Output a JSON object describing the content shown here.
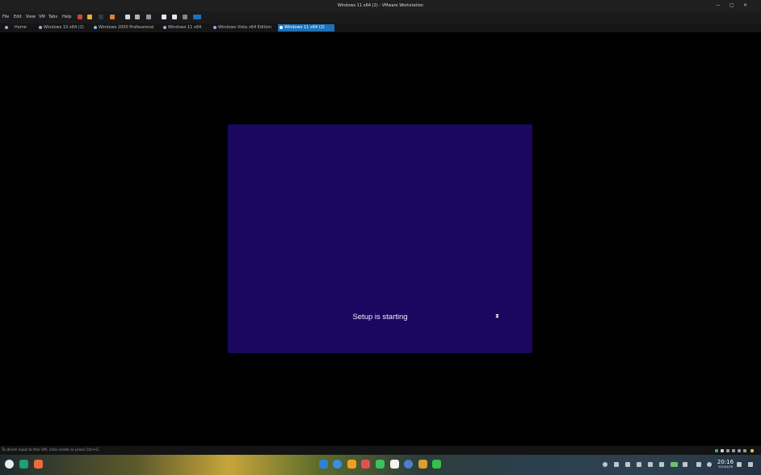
{
  "window": {
    "title": "Windows 11 x64 (2)   - VMware Workstation",
    "controls": [
      "—",
      "□",
      "✕"
    ]
  },
  "menu": [
    "File",
    "Edit",
    "View",
    "VM",
    "Tabs",
    "Help"
  ],
  "tabs": [
    {
      "label": "Home",
      "active": false
    },
    {
      "label": "Windows 10 x64 (2)",
      "active": false
    },
    {
      "label": "Windows 2000 Professional",
      "active": false
    },
    {
      "label": "Windows 11 x64",
      "active": false
    },
    {
      "label": "Windows Vista x64 Edition",
      "active": false
    },
    {
      "label": "Windows 11 x64 (2)",
      "active": true
    }
  ],
  "guest": {
    "background": "#1b0660",
    "message": "Setup is starting",
    "cursor_glyph": "⧗"
  },
  "statusbar": {
    "hint": "To direct input to this VM, click inside or press Ctrl+G."
  },
  "taskbar": {
    "clock_time": "20:16",
    "clock_date": "2024/4/28"
  },
  "colors": {
    "accent": "#1d72b8",
    "guest_bg": "#1b0660"
  }
}
